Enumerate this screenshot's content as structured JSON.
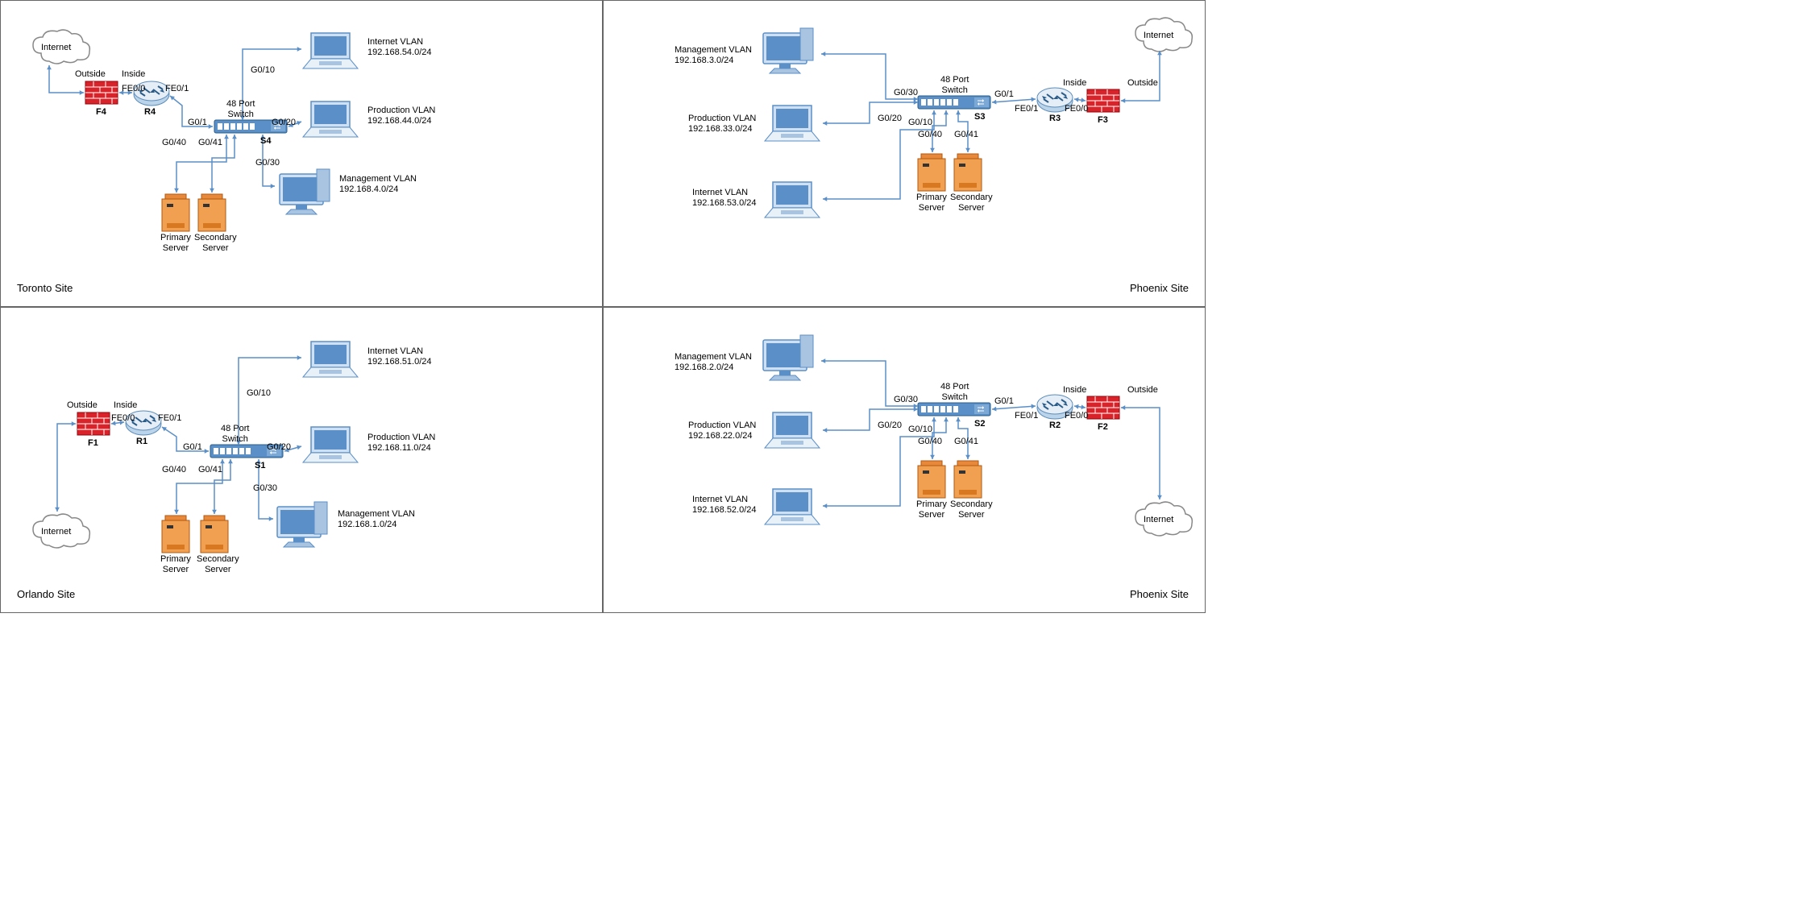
{
  "sites": [
    {
      "name": "Toronto Site",
      "internet": "Internet",
      "outside": "Outside",
      "inside": "Inside",
      "fw": "F4",
      "rtr": "R4",
      "sw": "S4",
      "swlbl": "48 Port\nSwitch",
      "if_fe00": "FE0/0",
      "if_fe01": "FE0/1",
      "if_g01": "G0/1",
      "if_g010": "G0/10",
      "if_g020": "G0/20",
      "if_g030": "G0/30",
      "if_g040": "G0/40",
      "if_g041": "G0/41",
      "pri": "Primary\nServer",
      "sec": "Secondary\nServer",
      "v1": "Internet VLAN",
      "v1ip": "192.168.54.0/24",
      "v2": "Production VLAN",
      "v2ip": "192.168.44.0/24",
      "v3": "Management VLAN",
      "v3ip": "192.168.4.0/24"
    },
    {
      "name": "Phoenix Site",
      "internet": "Internet",
      "outside": "Outside",
      "inside": "Inside",
      "fw": "F3",
      "rtr": "R3",
      "sw": "S3",
      "swlbl": "48 Port\nSwitch",
      "if_fe00": "FE0/0",
      "if_fe01": "FE0/1",
      "if_g01": "G0/1",
      "if_g010": "G0/10",
      "if_g020": "G0/20",
      "if_g030": "G0/30",
      "if_g040": "G0/40",
      "if_g041": "G0/41",
      "pri": "Primary\nServer",
      "sec": "Secondary\nServer",
      "v1": "Management VLAN",
      "v1ip": "192.168.3.0/24",
      "v2": "Production VLAN",
      "v2ip": "192.168.33.0/24",
      "v3": "Internet VLAN",
      "v3ip": "192.168.53.0/24"
    },
    {
      "name": "Orlando Site",
      "internet": "Internet",
      "outside": "Outside",
      "inside": "Inside",
      "fw": "F1",
      "rtr": "R1",
      "sw": "S1",
      "swlbl": "48 Port\nSwitch",
      "if_fe00": "FE0/0",
      "if_fe01": "FE0/1",
      "if_g01": "G0/1",
      "if_g010": "G0/10",
      "if_g020": "G0/20",
      "if_g030": "G0/30",
      "if_g040": "G0/40",
      "if_g041": "G0/41",
      "pri": "Primary\nServer",
      "sec": "Secondary\nServer",
      "v1": "Internet VLAN",
      "v1ip": "192.168.51.0/24",
      "v2": "Production VLAN",
      "v2ip": "192.168.11.0/24",
      "v3": "Management VLAN",
      "v3ip": "192.168.1.0/24"
    },
    {
      "name": "Phoenix Site",
      "internet": "Internet",
      "outside": "Outside",
      "inside": "Inside",
      "fw": "F2",
      "rtr": "R2",
      "sw": "S2",
      "swlbl": "48 Port\nSwitch",
      "if_fe00": "FE0/0",
      "if_fe01": "FE0/1",
      "if_g01": "G0/1",
      "if_g010": "G0/10",
      "if_g020": "G0/20",
      "if_g030": "G0/30",
      "if_g040": "G0/40",
      "if_g041": "G0/41",
      "pri": "Primary\nServer",
      "sec": "Secondary\nServer",
      "v1": "Management VLAN",
      "v1ip": "192.168.2.0/24",
      "v2": "Production VLAN",
      "v2ip": "192.168.22.0/24",
      "v3": "Internet VLAN",
      "v3ip": "192.168.52.0/24"
    }
  ]
}
